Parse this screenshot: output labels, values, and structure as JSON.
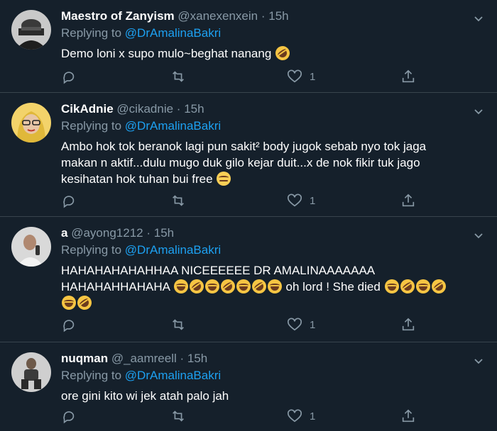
{
  "tweets": [
    {
      "name": "Maestro of Zanyism",
      "handle": "@xanexenxein",
      "time": "15h",
      "replying_prefix": "Replying to",
      "replying_to": "@DrAmalinaBakri",
      "text": "Demo loni x supo mulo~beghat nanang",
      "likes": "1",
      "avatar_icon": "masked-figure-avatar"
    },
    {
      "name": "CikAdnie",
      "handle": "@cikadnie",
      "time": "15h",
      "replying_prefix": "Replying to",
      "replying_to": "@DrAmalinaBakri",
      "text_lines": [
        "Ambo hok tok beranok lagi pun sakit² body jugok sebab nyo tok jaga",
        "makan n aktif...dulu mugo duk gilo kejar duit...x de nok fikir tuk jago",
        "kesihatan hok tuhan bui free"
      ],
      "likes": "1",
      "avatar_icon": "woman-glasses-avatar"
    },
    {
      "name": "a",
      "handle": "@ayong1212",
      "time": "15h",
      "replying_prefix": "Replying to",
      "replying_to": "@DrAmalinaBakri",
      "text_lines": [
        "HAHAHAHAHAHHAA NICEEEEEE DR AMALINAAAAAAA",
        "HAHAHAHHAHAHA",
        "oh lord ! She died"
      ],
      "likes": "1",
      "avatar_icon": "man-selfie-avatar"
    },
    {
      "name": "nuqman",
      "handle": "@_aamreell",
      "time": "15h",
      "replying_prefix": "Replying to",
      "replying_to": "@DrAmalinaBakri",
      "text": "ore gini kito wi jek atah palo jah",
      "likes": "1",
      "avatar_icon": "person-sitting-avatar"
    }
  ],
  "separator": "·",
  "colors": {
    "background": "#15202b",
    "muted": "#8899a6",
    "accent": "#1da1f2",
    "divider": "#38444d"
  }
}
